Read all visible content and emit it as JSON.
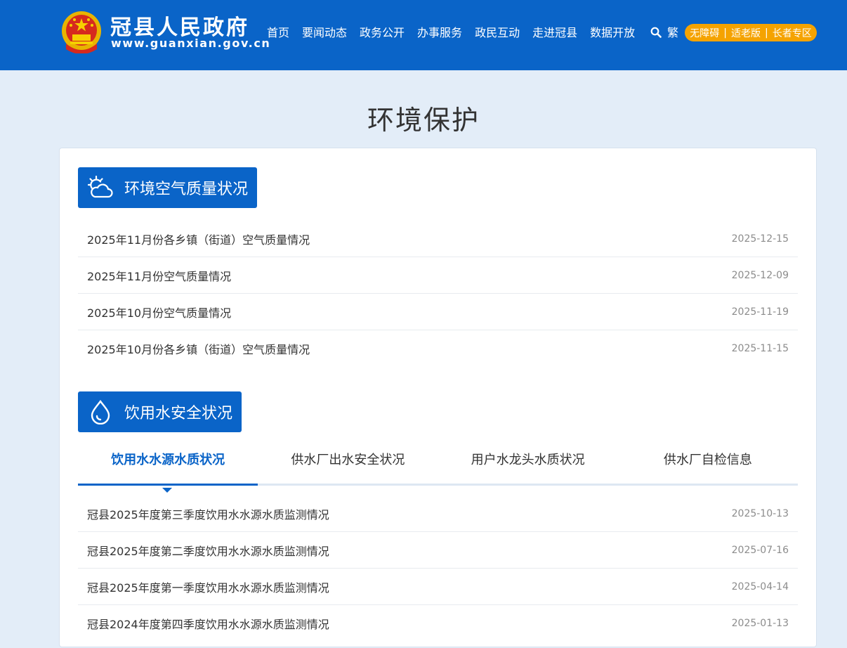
{
  "header": {
    "site_name": "冠县人民政府",
    "site_url": "www.guanxian.gov.cn",
    "nav": [
      "首页",
      "要闻动态",
      "政务公开",
      "办事服务",
      "政民互动",
      "走进冠县",
      "数据开放"
    ],
    "search_icon": "search-icon",
    "traditional": "繁",
    "accessibility": [
      "无障碍",
      "适老版",
      "长者专区"
    ],
    "separator": "|"
  },
  "page": {
    "title": "环境保护"
  },
  "air_section": {
    "title": "环境空气质量状况",
    "icon": "cloud-sun-icon",
    "items": [
      {
        "title": "2025年11月份各乡镇（街道）空气质量情况",
        "date": "2025-12-15"
      },
      {
        "title": "2025年11月份空气质量情况",
        "date": "2025-12-09"
      },
      {
        "title": "2025年10月份空气质量情况",
        "date": "2025-11-19"
      },
      {
        "title": "2025年10月份各乡镇（街道）空气质量情况",
        "date": "2025-11-15"
      }
    ]
  },
  "water_section": {
    "title": "饮用水安全状况",
    "icon": "water-drop-icon",
    "tabs": [
      "饮用水水源水质状况",
      "供水厂出水安全状况",
      "用户水龙头水质状况",
      "供水厂自检信息"
    ],
    "active_tab": "饮用水水源水质状况",
    "items": [
      {
        "title": "冠县2025年度第三季度饮用水水源水质监测情况",
        "date": "2025-10-13"
      },
      {
        "title": "冠县2025年度第二季度饮用水水源水质监测情况",
        "date": "2025-07-16"
      },
      {
        "title": "冠县2025年度第一季度饮用水水源水质监测情况",
        "date": "2025-04-14"
      },
      {
        "title": "冠县2024年度第四季度饮用水水源水质监测情况",
        "date": "2025-01-13"
      }
    ]
  },
  "colors": {
    "primary": "#0a64c8",
    "accent": "#f5a300",
    "background": "#e3edf8",
    "date_text": "#8c8c8c"
  }
}
